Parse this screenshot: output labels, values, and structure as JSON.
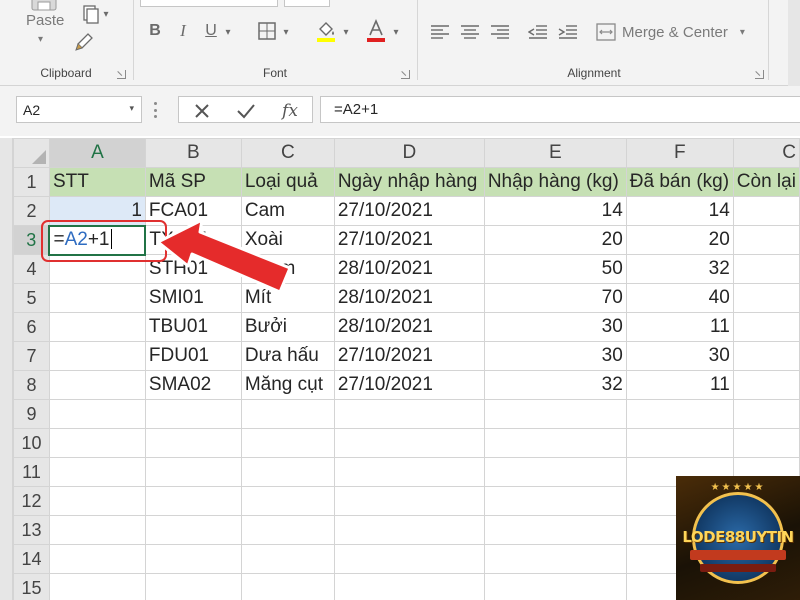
{
  "ribbon": {
    "clipboard": {
      "label": "Clipboard",
      "paste_label": "Paste"
    },
    "font": {
      "label": "Font"
    },
    "alignment": {
      "label": "Alignment",
      "merge_label": "Merge & Center"
    }
  },
  "formula_bar": {
    "name_box": "A2",
    "formula": "=A2+1"
  },
  "grid": {
    "columns": [
      "A",
      "B",
      "C",
      "D",
      "E",
      "F",
      "C"
    ],
    "rows": [
      "1",
      "2",
      "3",
      "4",
      "5",
      "6",
      "7",
      "8",
      "9",
      "10",
      "11",
      "12",
      "13",
      "14",
      "15"
    ],
    "headers": [
      "STT",
      "Mã SP",
      "Loại quả",
      "Ngày nhập hàng",
      "Nhập hàng (kg)",
      "Đã bán (kg)",
      "Còn lại"
    ],
    "data": [
      {
        "stt": "1",
        "code": "FCA01",
        "fruit": "Cam",
        "date": "27/10/2021",
        "imported": "14",
        "sold": "14"
      },
      {
        "stt": "",
        "code": "TXO01",
        "fruit": "Xoài",
        "date": "27/10/2021",
        "imported": "20",
        "sold": "20"
      },
      {
        "stt": "",
        "code": "STH01",
        "fruit": "Thơm",
        "date": "28/10/2021",
        "imported": "50",
        "sold": "32"
      },
      {
        "stt": "",
        "code": "SMI01",
        "fruit": "Mít",
        "date": "28/10/2021",
        "imported": "70",
        "sold": "40"
      },
      {
        "stt": "",
        "code": "TBU01",
        "fruit": "Bưởi",
        "date": "28/10/2021",
        "imported": "30",
        "sold": "11"
      },
      {
        "stt": "",
        "code": "FDU01",
        "fruit": "Dưa hấu",
        "date": "27/10/2021",
        "imported": "30",
        "sold": "30"
      },
      {
        "stt": "",
        "code": "SMA02",
        "fruit": "Măng cụt",
        "date": "27/10/2021",
        "imported": "32",
        "sold": "11"
      }
    ],
    "edit_formula": {
      "eq": "=",
      "ref": "A2",
      "rest": "+1"
    }
  },
  "watermark": {
    "text": "LODE88UYTIN"
  },
  "colors": {
    "header_fill": "#c6e0b4",
    "accent": "#217346",
    "annotation": "#e03030",
    "ref_blue": "#2e6cc1"
  },
  "icons": [
    "paste-icon",
    "copy-icon",
    "format-painter-icon",
    "bold-icon",
    "italic-icon",
    "underline-icon",
    "borders-icon",
    "fill-color-icon",
    "font-color-icon",
    "align-left-icon",
    "align-center-icon",
    "align-right-icon",
    "decrease-indent-icon",
    "increase-indent-icon",
    "merge-icon",
    "cancel-icon",
    "enter-icon",
    "insert-function-icon",
    "annotation-arrow-icon"
  ]
}
